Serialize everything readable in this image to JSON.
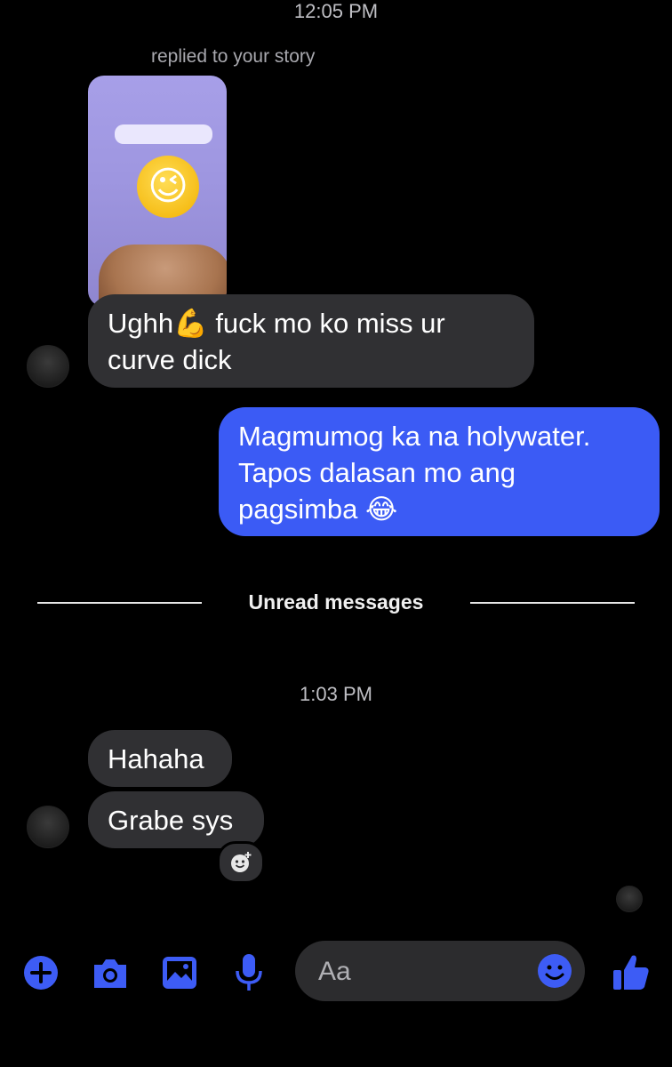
{
  "timestamps": {
    "first": "12:05 PM",
    "second": "1:03 PM"
  },
  "story_reply": {
    "note": "replied to your story"
  },
  "messages": {
    "incoming_1": "Ughh💪 fuck mo ko miss ur curve dick",
    "outgoing_1": "Magmumog ka na holywater. Tapos dalasan mo ang pagsimba 😂",
    "incoming_2": "Hahaha",
    "incoming_3": "Grabe sys"
  },
  "divider": {
    "label": "Unread messages"
  },
  "composer": {
    "placeholder": "Aa"
  },
  "icons": {
    "add": "plus-icon",
    "camera": "camera-icon",
    "gallery": "image-icon",
    "mic": "microphone-icon",
    "emoji": "emoji-icon",
    "like": "thumbs-up-icon",
    "react": "add-reaction-icon"
  },
  "colors": {
    "accent": "#3b5bf5",
    "bubble_in": "#303033",
    "background": "#000000"
  }
}
